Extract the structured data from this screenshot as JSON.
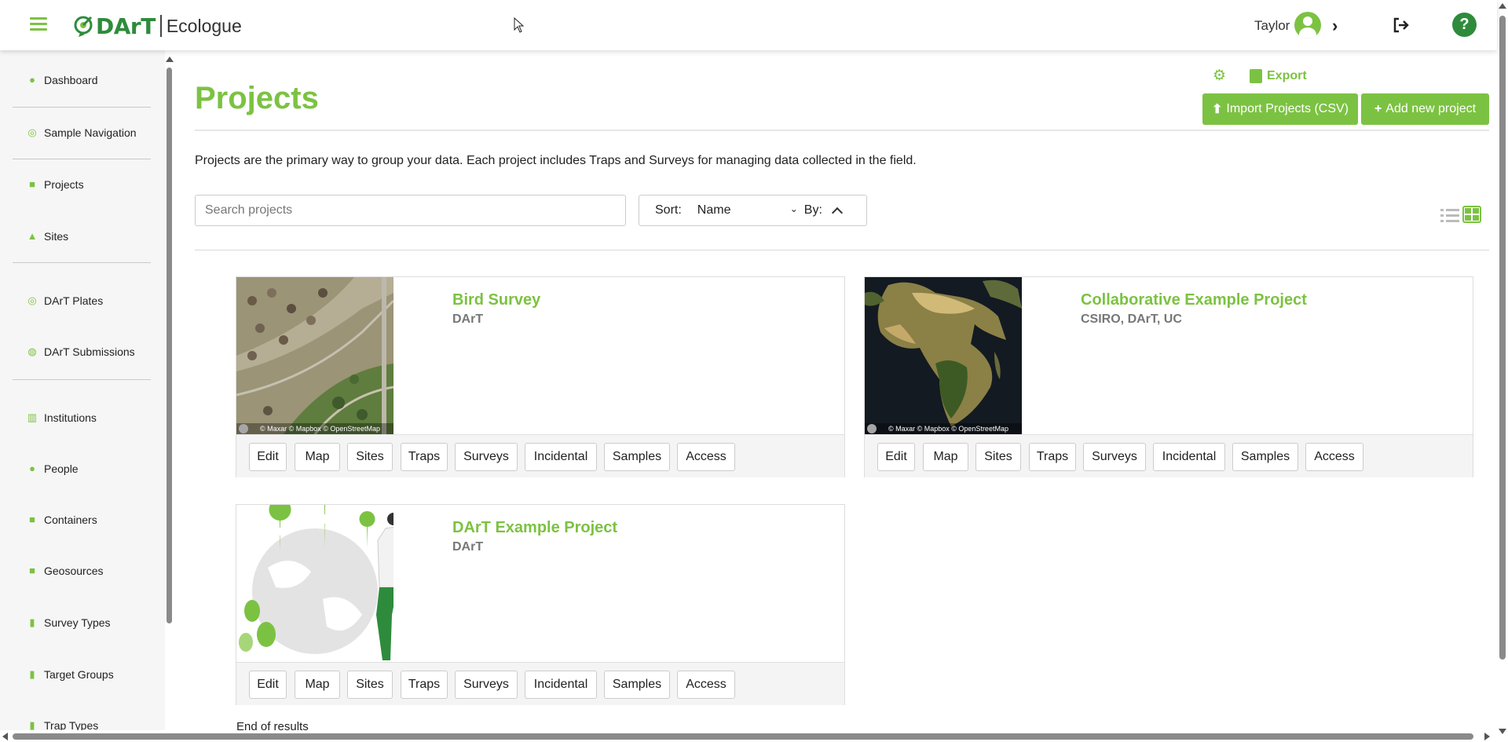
{
  "app": {
    "brand_short": "DArT",
    "brand_name": "Ecologue",
    "accent_color": "#7cc242",
    "brand_dark_color": "#2e8b3c"
  },
  "header": {
    "user_name": "Taylor",
    "icons": [
      "menu-icon",
      "user-avatar-icon",
      "chevron-right-icon",
      "logout-icon",
      "help-icon"
    ],
    "help_label": "?"
  },
  "sidebar": {
    "items": [
      {
        "label": "Dashboard",
        "icon": "info-icon"
      },
      {
        "label": "Sample Navigation",
        "icon": "dart-icon"
      },
      {
        "label": "Projects",
        "icon": "folder-icon"
      },
      {
        "label": "Sites",
        "icon": "map-marker-icon"
      },
      {
        "label": "DArT Plates",
        "icon": "dart-icon"
      },
      {
        "label": "DArT Submissions",
        "icon": "submission-icon"
      },
      {
        "label": "Institutions",
        "icon": "institution-icon"
      },
      {
        "label": "People",
        "icon": "people-icon"
      },
      {
        "label": "Containers",
        "icon": "box-icon"
      },
      {
        "label": "Geosources",
        "icon": "box-icon"
      },
      {
        "label": "Survey Types",
        "icon": "trash-icon"
      },
      {
        "label": "Target Groups",
        "icon": "trash-icon"
      },
      {
        "label": "Trap Types",
        "icon": "trash-icon"
      }
    ]
  },
  "page": {
    "title": "Projects",
    "export_label": "Export",
    "import_label": "Import Projects (CSV)",
    "add_label": "Add new project",
    "intro": "Projects are the primary way to group your data. Each project includes Traps and Surveys for managing data collected in the field.",
    "search_placeholder": "Search projects",
    "sort_label": "Sort:",
    "sort_value": "Name",
    "by_label": "By:",
    "end_text": "End of results"
  },
  "projects": [
    {
      "title": "Bird Survey",
      "org": "DArT",
      "thumb": "satellite-map",
      "attribution": "© Maxar © Mapbox © OpenStreetMap",
      "actions": [
        "Edit",
        "Map",
        "Sites",
        "Traps",
        "Surveys",
        "Incidental",
        "Samples",
        "Access"
      ]
    },
    {
      "title": "Collaborative Example Project",
      "org": "CSIRO, DArT, UC",
      "thumb": "satellite-map",
      "attribution": "© Maxar © Mapbox © OpenStreetMap",
      "actions": [
        "Edit",
        "Map",
        "Sites",
        "Traps",
        "Surveys",
        "Incidental",
        "Samples",
        "Access"
      ]
    },
    {
      "title": "DArT Example Project",
      "org": "DArT",
      "thumb": "illustration",
      "actions": [
        "Edit",
        "Map",
        "Sites",
        "Traps",
        "Surveys",
        "Incidental",
        "Samples",
        "Access"
      ]
    }
  ]
}
